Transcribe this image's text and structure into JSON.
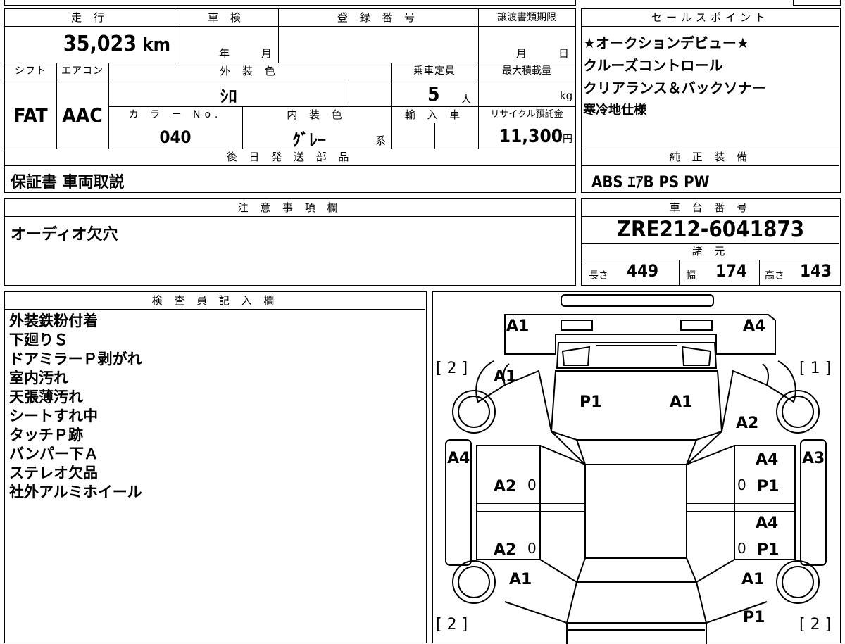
{
  "vehicle": {
    "mileage_label": "走 行",
    "mileage_value": "35,023",
    "mileage_unit": "km",
    "inspection_label": "車 検",
    "year_label": "年",
    "month_label": "月",
    "registration_label": "登 録 番 号",
    "transfer_label": "譲渡書類期限",
    "transfer_month": "月",
    "transfer_day": "日",
    "shift_label": "シフト",
    "shift_value": "FAT",
    "ac_label": "エアコン",
    "ac_value": "AAC",
    "exterior_color_label": "外 装 色",
    "exterior_color_value": "ｼﾛ",
    "capacity_label": "乗車定員",
    "capacity_value": "5",
    "capacity_unit": "人",
    "max_load_label": "最大積載量",
    "max_load_unit": "kg",
    "color_no_label": "カ ラ ー No.",
    "color_no_value": "040",
    "interior_color_label": "内 装 色",
    "interior_color_value": "ｸﾞﾚｰ",
    "interior_color_suffix": "系",
    "import_label": "輸 入 車",
    "recycle_label": "リサイクル預託金",
    "recycle_value": "11,300",
    "recycle_unit": "円",
    "later_parts_label": "後 日 発 送 部 品",
    "later_parts_value": "保証書 車両取説"
  },
  "sales": {
    "label": "セールスポイント",
    "points": [
      "★オークションデビュー★",
      "クルーズコントロール",
      "クリアランス＆バックソナー",
      "寒冷地仕様"
    ],
    "equipment_label": "純 正 装 備",
    "equipment_value": "ABS ｴｱB PS PW"
  },
  "notes": {
    "label": "注 意 事 項 欄",
    "value": "オーディオ欠穴"
  },
  "chassis": {
    "label": "車 台 番 号",
    "value": "ZRE212-6041873",
    "specs_label": "諸 元",
    "length_label": "長さ",
    "length_value": "449",
    "width_label": "幅",
    "width_value": "174",
    "height_label": "高さ",
    "height_value": "143"
  },
  "inspector": {
    "label": "検 査 員 記 入 欄",
    "lines": [
      "外装鉄粉付着",
      "下廻りＳ",
      "ドアミラーＰ剥がれ",
      "室内汚れ",
      "天張薄汚れ",
      "シートすれ中",
      "タッチＰ跡",
      "バンパー下Ａ",
      "ステレオ欠品",
      "社外アルミホイール"
    ]
  },
  "diagram": {
    "marks": {
      "front_left": "A1",
      "front_right": "A4",
      "bracket_tl": "[ 2 ]",
      "bracket_tr": "[ 1 ]",
      "bracket_bl": "[ 2 ]",
      "bracket_br": "[ 2 ]",
      "fender_left": "A1",
      "hood_left": "P1",
      "hood_right": "A1",
      "fender_right": "A2",
      "side_left": "A4",
      "door_fl": "A2",
      "door_fr_top": "A4",
      "door_fr_bottom": "P1",
      "side_right": "A3",
      "door_rl": "A2",
      "door_rr_top": "A4",
      "door_rr_bottom": "P1",
      "rear_left": "A1",
      "rear_right": "A1",
      "rear_bottom_right": "P1",
      "zero_1": "0",
      "zero_2": "0",
      "zero_3": "0",
      "zero_4": "0"
    }
  }
}
